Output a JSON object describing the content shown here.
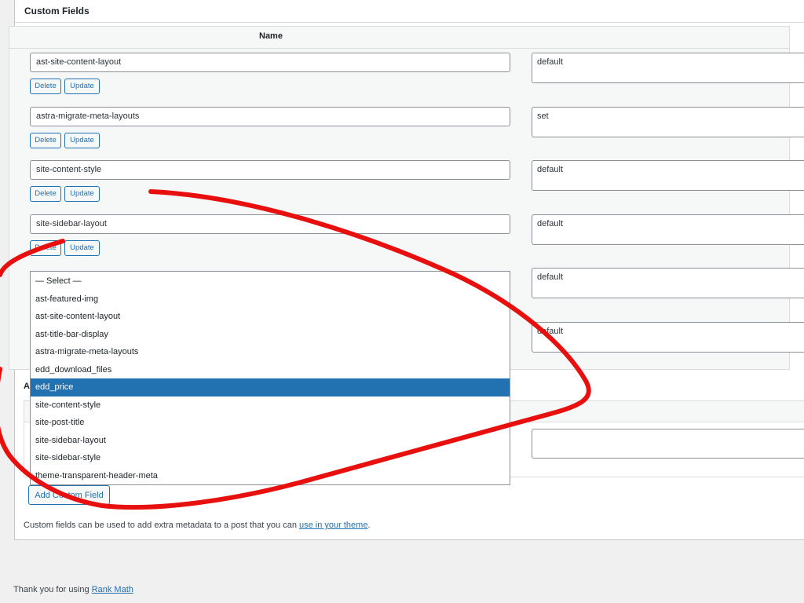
{
  "metabox": {
    "title": "Custom Fields",
    "column_name": "Name"
  },
  "fields": [
    {
      "key": "ast-site-content-layout",
      "value": "default"
    },
    {
      "key": "astra-migrate-meta-layouts",
      "value": "set"
    },
    {
      "key": "site-content-style",
      "value": "default"
    },
    {
      "key": "site-sidebar-layout",
      "value": "default"
    },
    {
      "key": "",
      "value": "default"
    },
    {
      "key": "",
      "value": "default"
    }
  ],
  "buttons": {
    "delete": "Delete",
    "update": "Update",
    "add_custom_field": "Add Custom Field"
  },
  "dropdown": {
    "options": [
      "— Select —",
      "ast-featured-img",
      "ast-site-content-layout",
      "ast-title-bar-display",
      "astra-migrate-meta-layouts",
      "edd_download_files",
      "edd_price",
      "site-content-style",
      "site-post-title",
      "site-sidebar-layout",
      "site-sidebar-style",
      "theme-transparent-header-meta"
    ],
    "selected_index": 6
  },
  "add_section": {
    "heading_fragment": "A"
  },
  "help": {
    "text_before": "Custom fields can be used to add extra metadata to a post that you can ",
    "link_text": "use in your theme",
    "text_after": "."
  },
  "footer": {
    "text_before": "Thank you for using ",
    "link_text": "Rank Math"
  },
  "annotation": {
    "color": "#e8100f"
  },
  "colors": {
    "accent": "#2271b1",
    "selected_bg": "#2271b1"
  }
}
